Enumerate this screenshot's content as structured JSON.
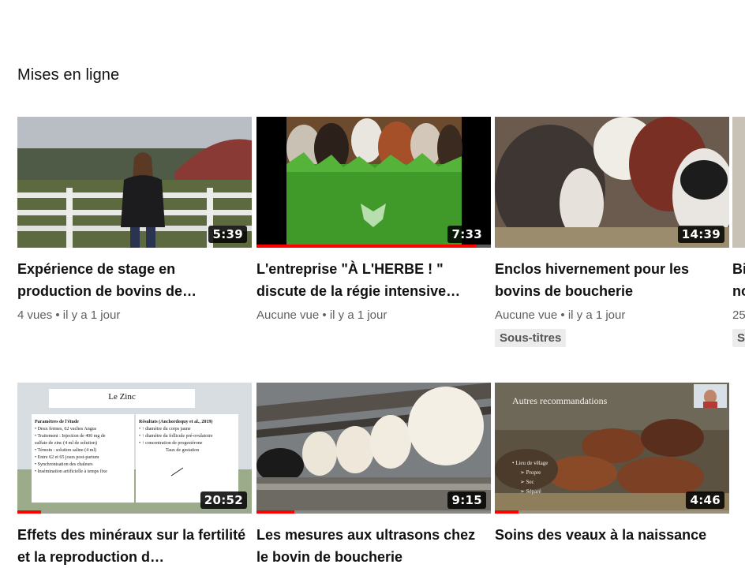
{
  "section": {
    "title": "Mises en ligne"
  },
  "colors": {
    "progress": "#ff0000",
    "badge_bg": "#ececec",
    "meta": "#606060"
  },
  "videos": [
    {
      "title": "Expérience de stage en production de bovins de…",
      "duration": "5:39",
      "meta": "4 vues • il y a 1 jour",
      "progress": 0,
      "thumb_icon": "student-at-farm-fence-thumbnail"
    },
    {
      "title": "L'entreprise \"À L'HERBE ! \" discute de la régie intensive…",
      "duration": "7:33",
      "meta": "Aucune vue • il y a 1 jour",
      "progress": 0.94,
      "thumb_icon": "cattle-on-grass-thumbnail"
    },
    {
      "title": "Enclos hivernement pour les bovins de boucherie",
      "duration": "14:39",
      "meta": "Aucune vue • il y a 1 jour",
      "badge": "Sous-titres",
      "progress": 0,
      "thumb_icon": "hereford-cattle-thumbnail"
    },
    {
      "title": "Effets des minéraux sur la fertilité et la reproduction d…",
      "duration": "20:52",
      "meta": "",
      "progress": 0.1,
      "thumb_icon": "slide-le-zinc-thumbnail",
      "slide": {
        "heading": "Le Zinc",
        "left_title": "Paramètres de l'étude",
        "left_items": [
          "• Deux fermes, 62 vaches Angus",
          "• Traitement : Injection de 400 mg de",
          "  sulfate de zinc (4 ml de solution)",
          "• Témoin : solution saline (4 ml)",
          "• Entre 62 et 65 jours post-partum",
          "• Synchronisation des chaleurs",
          "• Insémination artificielle à temps fixe"
        ],
        "right_title": "Résultats (Anchordoquy et al., 2019)",
        "right_items": [
          "• ↑ diamètre du corps jaune",
          "• ↑ diamètre du follicule pré-ovulatoire",
          "• ↑ concentration de progestérone",
          "Taux de gestation"
        ]
      }
    },
    {
      "title": "Les mesures aux ultrasons chez le bovin de boucherie",
      "duration": "9:15",
      "meta": "",
      "progress": 0.16,
      "thumb_icon": "cattle-in-barn-thumbnail"
    },
    {
      "title": "Soins des veaux à la naissance",
      "duration": "4:46",
      "meta": "",
      "progress": 0.1,
      "thumb_icon": "calves-slide-thumbnail",
      "slide": {
        "heading": "Autres recommandations",
        "items": [
          "• Lieu de vêlage",
          "➢ Propre",
          "➢ Sec",
          "➢ Séparé"
        ]
      }
    }
  ],
  "partial": {
    "title_prefix": "Bi no",
    "meta_prefix": "25",
    "badge_prefix": "S"
  }
}
